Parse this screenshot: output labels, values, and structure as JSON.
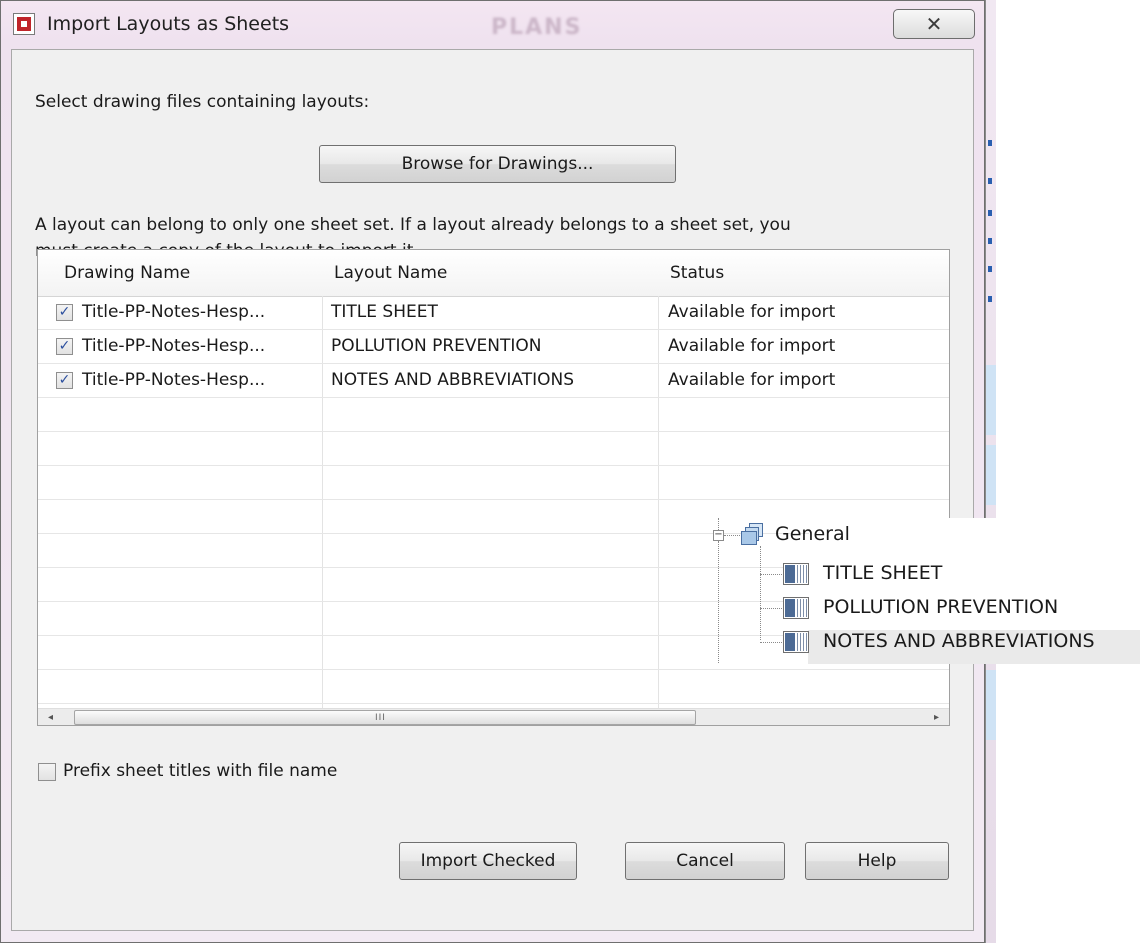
{
  "window": {
    "title": "Import Layouts as Sheets",
    "close_glyph": "✕",
    "background_watermark": "PLANS"
  },
  "instructions": {
    "select_label": "Select drawing files containing layouts:",
    "browse_button": "Browse for Drawings...",
    "note_line1": "A layout can belong to only one sheet set. If a layout already belongs to a sheet set, you",
    "note_line2": "must create a copy of the layout to import it."
  },
  "table": {
    "columns": [
      "Drawing Name",
      "Layout Name",
      "Status"
    ],
    "rows": [
      {
        "checked": true,
        "drawing": "Title-PP-Notes-Hesp...",
        "layout": "TITLE SHEET",
        "status": "Available for import"
      },
      {
        "checked": true,
        "drawing": "Title-PP-Notes-Hesp...",
        "layout": "POLLUTION PREVENTION",
        "status": "Available for import"
      },
      {
        "checked": true,
        "drawing": "Title-PP-Notes-Hesp...",
        "layout": "NOTES AND ABBREVIATIONS",
        "status": "Available for import"
      }
    ],
    "scroll_left": "◂",
    "scroll_right": "▸",
    "scroll_grip": "III"
  },
  "options": {
    "prefix_label": "Prefix sheet titles with file name",
    "prefix_checked": false
  },
  "buttons": {
    "import": "Import Checked",
    "cancel": "Cancel",
    "help": "Help"
  },
  "tree": {
    "expander": "−",
    "group": "General",
    "sheets": [
      "TITLE SHEET",
      "POLLUTION PREVENTION",
      "NOTES AND ABBREVIATIONS"
    ]
  },
  "colors": {
    "dialog_bg": "#f0f0f0",
    "check_color": "#2c4f9e",
    "titlebar_tint": "#f4e6f2"
  },
  "icons": {
    "app": "autocad-app-icon",
    "close": "close-icon",
    "checkbox": "checkbox-icon",
    "group": "sheet-set-group-icon",
    "sheet": "sheet-icon"
  }
}
